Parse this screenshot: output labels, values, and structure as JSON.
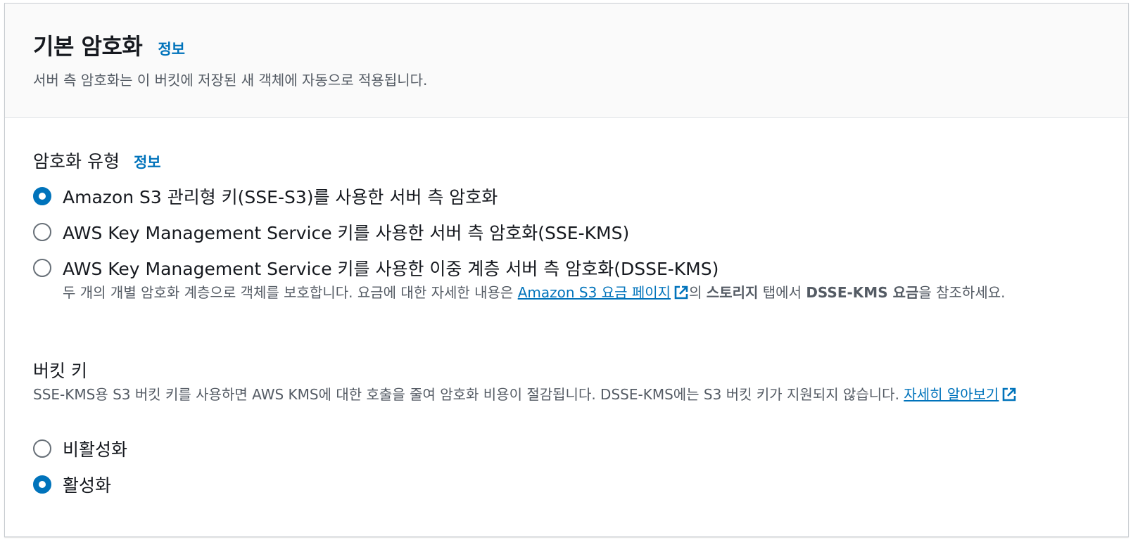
{
  "header": {
    "title": "기본 암호화",
    "info_link": "정보",
    "description": "서버 측 암호화는 이 버킷에 저장된 새 객체에 자동으로 적용됩니다."
  },
  "encryption_type": {
    "label": "암호화 유형",
    "info_link": "정보",
    "options": [
      {
        "label": "Amazon S3 관리형 키(SSE-S3)를 사용한 서버 측 암호화",
        "selected": true
      },
      {
        "label": "AWS Key Management Service 키를 사용한 서버 측 암호화(SSE-KMS)",
        "selected": false
      },
      {
        "label": "AWS Key Management Service 키를 사용한 이중 계층 서버 측 암호화(DSSE-KMS)",
        "selected": false
      }
    ],
    "dsse_description": {
      "part1": "두 개의 개별 암호화 계층으로 객체를 보호합니다. 요금에 대한 자세한 내용은 ",
      "link": "Amazon S3 요금 페이지",
      "part2": "의 ",
      "bold1": "스토리지",
      "part3": " 탭에서 ",
      "bold2": "DSSE-KMS 요금",
      "part4": "을 참조하세요."
    }
  },
  "bucket_key": {
    "label": "버킷 키",
    "description": "SSE-KMS용 S3 버킷 키를 사용하면 AWS KMS에 대한 호출을 줄여 암호화 비용이 절감됩니다. DSSE-KMS에는 S3 버킷 키가 지원되지 않습니다. ",
    "learn_more_link": "자세히 알아보기",
    "options": [
      {
        "label": "비활성화",
        "selected": false
      },
      {
        "label": "활성화",
        "selected": true
      }
    ]
  },
  "icons": {
    "external_link": "external-link-icon",
    "radio_checked": "radio-checked-icon",
    "radio_unchecked": "radio-unchecked-icon"
  },
  "colors": {
    "accent": "#0073bb",
    "text_primary": "#16191f",
    "text_secondary": "#545b64",
    "header_bg": "#fafafa",
    "border": "#c8ccd1"
  }
}
